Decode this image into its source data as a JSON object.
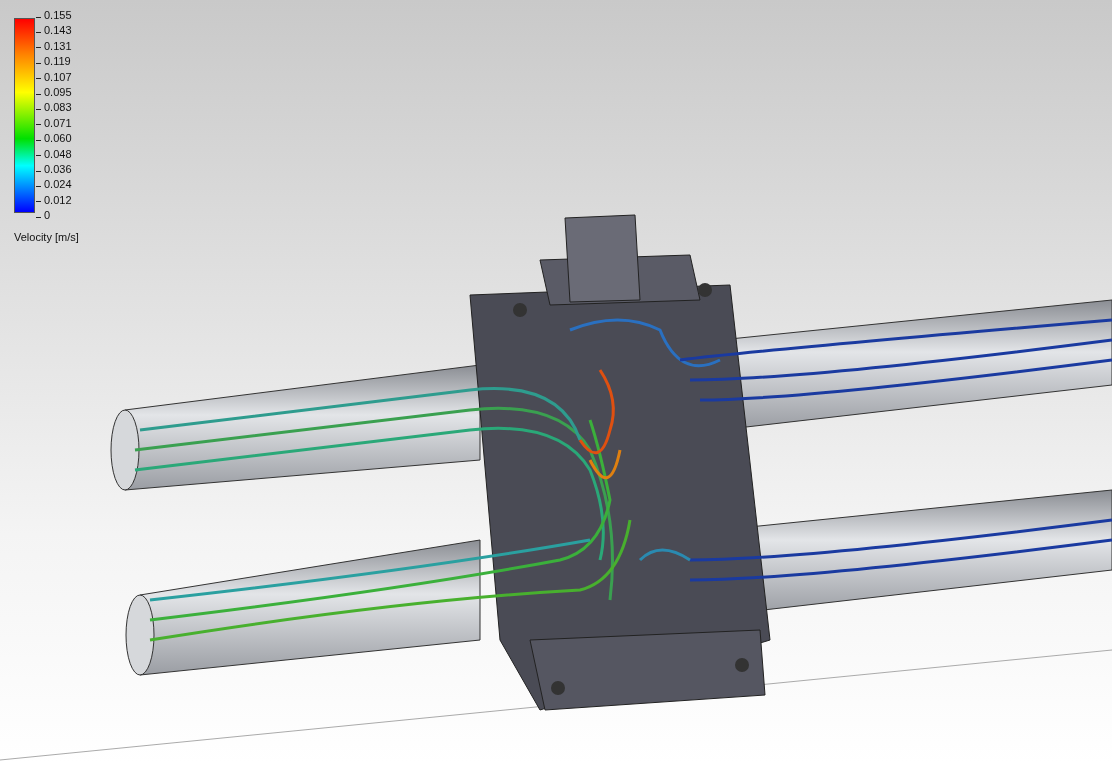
{
  "legend": {
    "tick_labels": [
      "0.155",
      "0.143",
      "0.131",
      "0.119",
      "0.107",
      "0.095",
      "0.083",
      "0.071",
      "0.060",
      "0.048",
      "0.036",
      "0.024",
      "0.012",
      "0"
    ],
    "title": "Velocity [m/s]"
  }
}
